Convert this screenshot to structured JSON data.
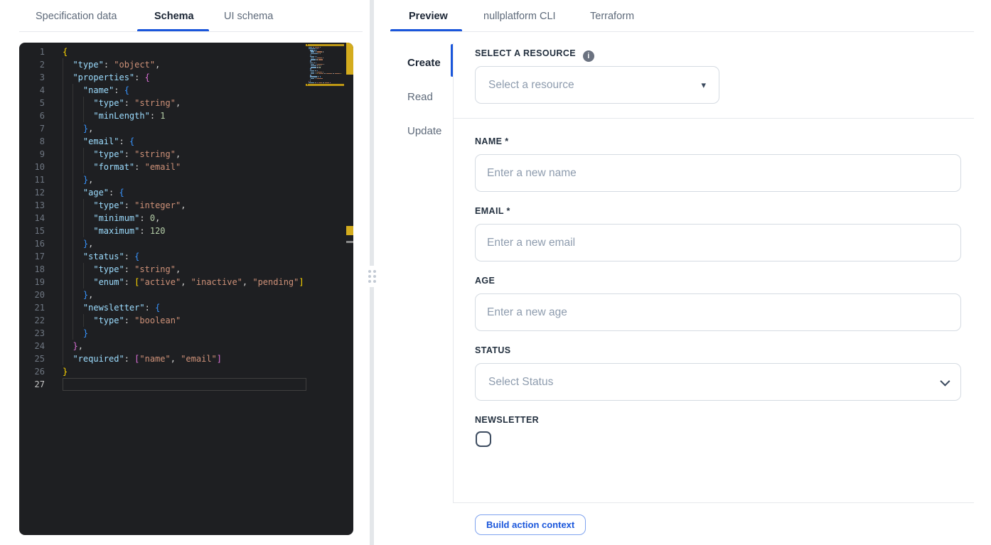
{
  "left_panel": {
    "tabs": [
      {
        "label": "Specification data",
        "active": false
      },
      {
        "label": "Schema",
        "active": true
      },
      {
        "label": "UI schema",
        "active": false
      }
    ],
    "editor": {
      "language": "json",
      "active_line": 27,
      "highlighted_lines": [
        1,
        26
      ],
      "lines": [
        {
          "n": 1,
          "i": 0,
          "t": [
            [
              "b1",
              "{"
            ]
          ]
        },
        {
          "n": 2,
          "i": 2,
          "t": [
            [
              "key",
              "\"type\""
            ],
            [
              "pun",
              ": "
            ],
            [
              "str",
              "\"object\""
            ],
            [
              "pun",
              ","
            ]
          ]
        },
        {
          "n": 3,
          "i": 2,
          "t": [
            [
              "key",
              "\"properties\""
            ],
            [
              "pun",
              ": "
            ],
            [
              "b2",
              "{"
            ]
          ]
        },
        {
          "n": 4,
          "i": 4,
          "t": [
            [
              "key",
              "\"name\""
            ],
            [
              "pun",
              ": "
            ],
            [
              "b3",
              "{"
            ]
          ]
        },
        {
          "n": 5,
          "i": 6,
          "t": [
            [
              "key",
              "\"type\""
            ],
            [
              "pun",
              ": "
            ],
            [
              "str",
              "\"string\""
            ],
            [
              "pun",
              ","
            ]
          ]
        },
        {
          "n": 6,
          "i": 6,
          "t": [
            [
              "key",
              "\"minLength\""
            ],
            [
              "pun",
              ": "
            ],
            [
              "num",
              "1"
            ]
          ]
        },
        {
          "n": 7,
          "i": 4,
          "t": [
            [
              "b3",
              "}"
            ],
            [
              "pun",
              ","
            ]
          ]
        },
        {
          "n": 8,
          "i": 4,
          "t": [
            [
              "key",
              "\"email\""
            ],
            [
              "pun",
              ": "
            ],
            [
              "b3",
              "{"
            ]
          ]
        },
        {
          "n": 9,
          "i": 6,
          "t": [
            [
              "key",
              "\"type\""
            ],
            [
              "pun",
              ": "
            ],
            [
              "str",
              "\"string\""
            ],
            [
              "pun",
              ","
            ]
          ]
        },
        {
          "n": 10,
          "i": 6,
          "t": [
            [
              "key",
              "\"format\""
            ],
            [
              "pun",
              ": "
            ],
            [
              "str",
              "\"email\""
            ]
          ]
        },
        {
          "n": 11,
          "i": 4,
          "t": [
            [
              "b3",
              "}"
            ],
            [
              "pun",
              ","
            ]
          ]
        },
        {
          "n": 12,
          "i": 4,
          "t": [
            [
              "key",
              "\"age\""
            ],
            [
              "pun",
              ": "
            ],
            [
              "b3",
              "{"
            ]
          ]
        },
        {
          "n": 13,
          "i": 6,
          "t": [
            [
              "key",
              "\"type\""
            ],
            [
              "pun",
              ": "
            ],
            [
              "str",
              "\"integer\""
            ],
            [
              "pun",
              ","
            ]
          ]
        },
        {
          "n": 14,
          "i": 6,
          "t": [
            [
              "key",
              "\"minimum\""
            ],
            [
              "pun",
              ": "
            ],
            [
              "num",
              "0"
            ],
            [
              "pun",
              ","
            ]
          ]
        },
        {
          "n": 15,
          "i": 6,
          "t": [
            [
              "key",
              "\"maximum\""
            ],
            [
              "pun",
              ": "
            ],
            [
              "num",
              "120"
            ]
          ]
        },
        {
          "n": 16,
          "i": 4,
          "t": [
            [
              "b3",
              "}"
            ],
            [
              "pun",
              ","
            ]
          ]
        },
        {
          "n": 17,
          "i": 4,
          "t": [
            [
              "key",
              "\"status\""
            ],
            [
              "pun",
              ": "
            ],
            [
              "b3",
              "{"
            ]
          ]
        },
        {
          "n": 18,
          "i": 6,
          "t": [
            [
              "key",
              "\"type\""
            ],
            [
              "pun",
              ": "
            ],
            [
              "str",
              "\"string\""
            ],
            [
              "pun",
              ","
            ]
          ]
        },
        {
          "n": 19,
          "i": 6,
          "t": [
            [
              "key",
              "\"enum\""
            ],
            [
              "pun",
              ": "
            ],
            [
              "b1",
              "["
            ],
            [
              "str",
              "\"active\""
            ],
            [
              "pun",
              ", "
            ],
            [
              "str",
              "\"inactive\""
            ],
            [
              "pun",
              ", "
            ],
            [
              "str",
              "\"pending\""
            ],
            [
              "b1",
              "]"
            ]
          ]
        },
        {
          "n": 20,
          "i": 4,
          "t": [
            [
              "b3",
              "}"
            ],
            [
              "pun",
              ","
            ]
          ]
        },
        {
          "n": 21,
          "i": 4,
          "t": [
            [
              "key",
              "\"newsletter\""
            ],
            [
              "pun",
              ": "
            ],
            [
              "b3",
              "{"
            ]
          ]
        },
        {
          "n": 22,
          "i": 6,
          "t": [
            [
              "key",
              "\"type\""
            ],
            [
              "pun",
              ": "
            ],
            [
              "str",
              "\"boolean\""
            ]
          ]
        },
        {
          "n": 23,
          "i": 4,
          "t": [
            [
              "b3",
              "}"
            ]
          ]
        },
        {
          "n": 24,
          "i": 2,
          "t": [
            [
              "b2",
              "}"
            ],
            [
              "pun",
              ","
            ]
          ]
        },
        {
          "n": 25,
          "i": 2,
          "t": [
            [
              "key",
              "\"required\""
            ],
            [
              "pun",
              ": "
            ],
            [
              "b2",
              "["
            ],
            [
              "str",
              "\"name\""
            ],
            [
              "pun",
              ", "
            ],
            [
              "str",
              "\"email\""
            ],
            [
              "b2",
              "]"
            ]
          ]
        },
        {
          "n": 26,
          "i": 0,
          "t": [
            [
              "b1",
              "}"
            ]
          ]
        },
        {
          "n": 27,
          "i": 0,
          "t": []
        }
      ]
    }
  },
  "right_panel": {
    "tabs": [
      {
        "label": "Preview",
        "active": true
      },
      {
        "label": "nullplatform CLI",
        "active": false
      },
      {
        "label": "Terraform",
        "active": false
      }
    ],
    "actions_nav": [
      {
        "label": "Create",
        "active": true
      },
      {
        "label": "Read",
        "active": false
      },
      {
        "label": "Update",
        "active": false
      }
    ],
    "form": {
      "resource_label": "SELECT A RESOURCE",
      "resource_info_icon": "info-icon",
      "resource_placeholder": "Select a resource",
      "fields": [
        {
          "label": "NAME *",
          "placeholder": "Enter a new name",
          "control": "text"
        },
        {
          "label": "EMAIL *",
          "placeholder": "Enter a new email",
          "control": "text"
        },
        {
          "label": "AGE",
          "placeholder": "Enter a new age",
          "control": "text"
        },
        {
          "label": "STATUS",
          "placeholder": "Select Status",
          "control": "select"
        },
        {
          "label": "NEWSLETTER",
          "control": "checkbox",
          "checked": false
        }
      ],
      "submit_label": "Build action context"
    }
  },
  "colors": {
    "accent_blue": "#1a56db",
    "editor_bg": "#1e1f22",
    "bracket_gold": "#ffd700",
    "bracket_pink": "#da70d6",
    "bracket_blue": "#3794ff",
    "key_blue": "#9cdcfe",
    "string_orange": "#ce9178",
    "number_green": "#b5cea8",
    "minimap_highlight": "#bd9714"
  }
}
